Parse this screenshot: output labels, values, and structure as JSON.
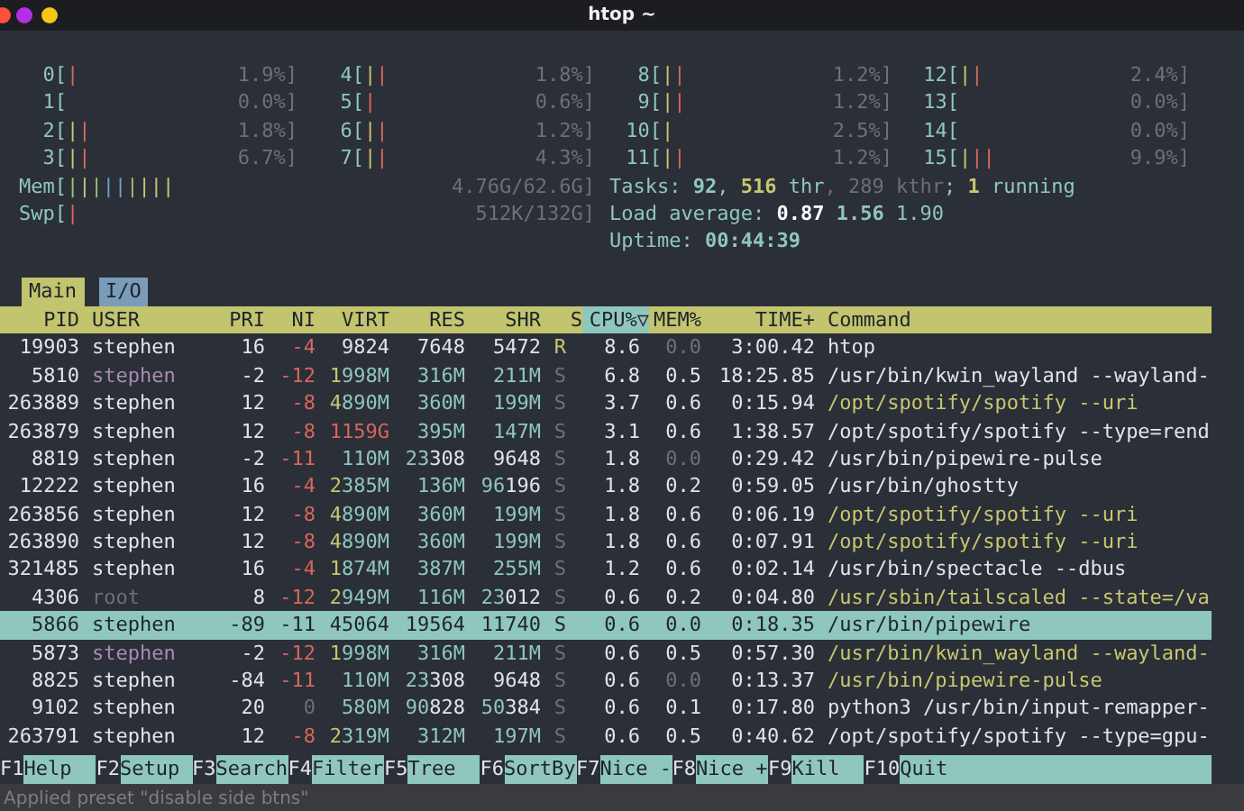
{
  "window": {
    "title": "htop ~"
  },
  "cpu_meters": [
    {
      "label": "0[",
      "bars": [
        {
          "text": "|",
          "color": "#d9665c"
        }
      ],
      "reading": "1.9%]"
    },
    {
      "label": "1[",
      "reading": "0.0%]"
    },
    {
      "label": "2[",
      "bars": [
        {
          "text": "|",
          "color": "#c8c76e"
        },
        {
          "text": "|",
          "color": "#d9665c"
        }
      ],
      "reading": "1.8%]"
    },
    {
      "label": "3[",
      "bars": [
        {
          "text": "|",
          "color": "#c8c76e"
        },
        {
          "text": "|",
          "color": "#d9665c"
        }
      ],
      "reading": "6.7%]"
    },
    {
      "label": "4[",
      "bars": [
        {
          "text": "|",
          "color": "#c8c76e"
        },
        {
          "text": "|",
          "color": "#d9665c"
        }
      ],
      "reading": "1.8%]"
    },
    {
      "label": "5[",
      "bars": [
        {
          "text": "|",
          "color": "#d9665c"
        }
      ],
      "reading": "0.6%]"
    },
    {
      "label": "6[",
      "bars": [
        {
          "text": "|",
          "color": "#c8c76e"
        },
        {
          "text": "|",
          "color": "#d9665c"
        }
      ],
      "reading": "1.2%]"
    },
    {
      "label": "7[",
      "bars": [
        {
          "text": "|",
          "color": "#c8c76e"
        },
        {
          "text": "|",
          "color": "#d9665c"
        }
      ],
      "reading": "4.3%]"
    },
    {
      "label": "8[",
      "bars": [
        {
          "text": "|",
          "color": "#c8c76e"
        },
        {
          "text": "|",
          "color": "#d9665c"
        }
      ],
      "reading": "1.2%]"
    },
    {
      "label": "9[",
      "bars": [
        {
          "text": "|",
          "color": "#c8c76e"
        },
        {
          "text": "|",
          "color": "#d9665c"
        }
      ],
      "reading": "1.2%]"
    },
    {
      "label": "10[",
      "bars": [
        {
          "text": "|",
          "color": "#c8c76e"
        }
      ],
      "reading": "2.5%]"
    },
    {
      "label": "11[",
      "bars": [
        {
          "text": "|",
          "color": "#c8c76e"
        },
        {
          "text": "|",
          "color": "#d9665c"
        }
      ],
      "reading": "1.2%]"
    },
    {
      "label": "12[",
      "bars": [
        {
          "text": "|",
          "color": "#c8c76e"
        },
        {
          "text": "|",
          "color": "#d9665c"
        }
      ],
      "reading": "2.4%]"
    },
    {
      "label": "13[",
      "reading": "0.0%]"
    },
    {
      "label": "14[",
      "reading": "0.0%]"
    },
    {
      "label": "15[",
      "bars": [
        {
          "text": "|",
          "color": "#c8c76e"
        },
        {
          "text": "||",
          "color": "#d9665c"
        }
      ],
      "reading": "9.9%]"
    }
  ],
  "memory_meters": [
    {
      "label": "Mem[",
      "bars": [
        {
          "text": "|",
          "color": "#9ec16c"
        },
        {
          "text": "|",
          "color": "#c8c76e"
        },
        {
          "text": "|",
          "color": "#9ec16c"
        },
        {
          "text": "||",
          "color": "#6d9ec9"
        },
        {
          "text": "|",
          "color": "#9ec16c"
        },
        {
          "text": "|||",
          "color": "#c8c76e"
        }
      ],
      "reading": "4.76G/62.6G]"
    },
    {
      "label": "Swp[",
      "bars": [
        {
          "text": "|",
          "color": "#d9665c"
        }
      ],
      "reading": "512K/132G]"
    }
  ],
  "summary": [
    [
      {
        "text": "Tasks: ",
        "color": "#8fc7bd"
      },
      {
        "text": "92",
        "color": "#8fc7bd",
        "bold": true
      },
      {
        "text": ", ",
        "color": "#8fc7bd"
      },
      {
        "text": "516",
        "color": "#c8c76e",
        "bold": true
      },
      {
        "text": " thr",
        "color": "#8fc7bd"
      },
      {
        "text": ", 289 kthr",
        "color": "#6b707a"
      },
      {
        "text": "; ",
        "color": "#8fc7bd"
      },
      {
        "text": "1",
        "color": "#c8c76e",
        "bold": true
      },
      {
        "text": " running",
        "color": "#8fc7bd"
      }
    ],
    [
      {
        "text": "Load average: ",
        "color": "#8fc7bd"
      },
      {
        "text": "0.87",
        "color": "#ffffff",
        "bold": true
      },
      {
        "text": " 1.56",
        "color": "#8fc7bd",
        "bold": true
      },
      {
        "text": " 1.90",
        "color": "#8fc7bd"
      }
    ],
    [
      {
        "text": "Uptime: ",
        "color": "#8fc7bd"
      },
      {
        "text": "00:44:39",
        "color": "#8fc7bd",
        "bold": true
      }
    ]
  ],
  "tabs": [
    {
      "label": "Main",
      "selected": true
    },
    {
      "label": "I/O",
      "selected": false
    }
  ],
  "columns": [
    {
      "label": "PID",
      "selected": false
    },
    {
      "label": "USER",
      "selected": false
    },
    {
      "label": "PRI",
      "selected": false
    },
    {
      "label": "NI",
      "selected": false
    },
    {
      "label": "VIRT",
      "selected": false
    },
    {
      "label": "RES",
      "selected": false
    },
    {
      "label": "SHR",
      "selected": false
    },
    {
      "label": "S",
      "selected": false
    },
    {
      "label": "CPU%▽",
      "selected": true
    },
    {
      "label": "MEM%",
      "selected": false
    },
    {
      "label": "TIME+",
      "selected": false
    },
    {
      "label": "Command",
      "selected": false
    }
  ],
  "processes": [
    {
      "selected": false,
      "cells": [
        "19903",
        "stephen",
        "16",
        [
          {
            "text": "-4",
            "color": "#d9665c"
          }
        ],
        "9824",
        "7648",
        "5472",
        [
          {
            "text": "R",
            "color": "#c8c76e"
          }
        ],
        "8.6",
        [
          {
            "text": "0.0",
            "color": "#6b707a"
          }
        ],
        "3:00.42",
        "htop"
      ]
    },
    {
      "selected": false,
      "cells": [
        "5810",
        [
          {
            "text": "stephen",
            "color": "#a98bb3"
          }
        ],
        "-2",
        [
          {
            "text": "-12",
            "color": "#d9665c"
          }
        ],
        [
          {
            "text": "1",
            "color": "#c8c76e"
          },
          {
            "text": "998M",
            "color": "#8fc7bd"
          }
        ],
        [
          {
            "text": "316M",
            "color": "#8fc7bd"
          }
        ],
        [
          {
            "text": "211M",
            "color": "#8fc7bd"
          }
        ],
        [
          {
            "text": "S",
            "color": "#6b707a"
          }
        ],
        "6.8",
        "0.5",
        "18:25.85",
        "/usr/bin/kwin_wayland --wayland-"
      ]
    },
    {
      "selected": false,
      "cells": [
        "263889",
        "stephen",
        "12",
        [
          {
            "text": "-8",
            "color": "#d9665c"
          }
        ],
        [
          {
            "text": "4",
            "color": "#c8c76e"
          },
          {
            "text": "890M",
            "color": "#8fc7bd"
          }
        ],
        [
          {
            "text": "360M",
            "color": "#8fc7bd"
          }
        ],
        [
          {
            "text": "199M",
            "color": "#8fc7bd"
          }
        ],
        [
          {
            "text": "S",
            "color": "#6b707a"
          }
        ],
        "3.7",
        "0.6",
        "0:15.94",
        [
          {
            "text": "/opt/spotify/spotify --uri",
            "color": "#c8c76e"
          }
        ]
      ]
    },
    {
      "selected": false,
      "cells": [
        "263879",
        "stephen",
        "12",
        [
          {
            "text": "-8",
            "color": "#d9665c"
          }
        ],
        [
          {
            "text": "1159G",
            "color": "#d9665c"
          }
        ],
        [
          {
            "text": "395M",
            "color": "#8fc7bd"
          }
        ],
        [
          {
            "text": "147M",
            "color": "#8fc7bd"
          }
        ],
        [
          {
            "text": "S",
            "color": "#6b707a"
          }
        ],
        "3.1",
        "0.6",
        "1:38.57",
        "/opt/spotify/spotify --type=rend"
      ]
    },
    {
      "selected": false,
      "cells": [
        "8819",
        "stephen",
        "-2",
        [
          {
            "text": "-11",
            "color": "#d9665c"
          }
        ],
        [
          {
            "text": "110M",
            "color": "#8fc7bd"
          }
        ],
        [
          {
            "text": "23",
            "color": "#8fc7bd"
          },
          {
            "text": "308",
            "color": "#e2e4e6"
          }
        ],
        "9648",
        [
          {
            "text": "S",
            "color": "#6b707a"
          }
        ],
        "1.8",
        [
          {
            "text": "0.0",
            "color": "#6b707a"
          }
        ],
        "0:29.42",
        "/usr/bin/pipewire-pulse"
      ]
    },
    {
      "selected": false,
      "cells": [
        "12222",
        "stephen",
        "16",
        [
          {
            "text": "-4",
            "color": "#d9665c"
          }
        ],
        [
          {
            "text": "2",
            "color": "#c8c76e"
          },
          {
            "text": "385M",
            "color": "#8fc7bd"
          }
        ],
        [
          {
            "text": "136M",
            "color": "#8fc7bd"
          }
        ],
        [
          {
            "text": "96",
            "color": "#8fc7bd"
          },
          {
            "text": "196",
            "color": "#e2e4e6"
          }
        ],
        [
          {
            "text": "S",
            "color": "#6b707a"
          }
        ],
        "1.8",
        "0.2",
        "0:59.05",
        "/usr/bin/ghostty"
      ]
    },
    {
      "selected": false,
      "cells": [
        "263856",
        "stephen",
        "12",
        [
          {
            "text": "-8",
            "color": "#d9665c"
          }
        ],
        [
          {
            "text": "4",
            "color": "#c8c76e"
          },
          {
            "text": "890M",
            "color": "#8fc7bd"
          }
        ],
        [
          {
            "text": "360M",
            "color": "#8fc7bd"
          }
        ],
        [
          {
            "text": "199M",
            "color": "#8fc7bd"
          }
        ],
        [
          {
            "text": "S",
            "color": "#6b707a"
          }
        ],
        "1.8",
        "0.6",
        "0:06.19",
        [
          {
            "text": "/opt/spotify/spotify --uri",
            "color": "#c8c76e"
          }
        ]
      ]
    },
    {
      "selected": false,
      "cells": [
        "263890",
        "stephen",
        "12",
        [
          {
            "text": "-8",
            "color": "#d9665c"
          }
        ],
        [
          {
            "text": "4",
            "color": "#c8c76e"
          },
          {
            "text": "890M",
            "color": "#8fc7bd"
          }
        ],
        [
          {
            "text": "360M",
            "color": "#8fc7bd"
          }
        ],
        [
          {
            "text": "199M",
            "color": "#8fc7bd"
          }
        ],
        [
          {
            "text": "S",
            "color": "#6b707a"
          }
        ],
        "1.8",
        "0.6",
        "0:07.91",
        [
          {
            "text": "/opt/spotify/spotify --uri",
            "color": "#c8c76e"
          }
        ]
      ]
    },
    {
      "selected": false,
      "cells": [
        "321485",
        "stephen",
        "16",
        [
          {
            "text": "-4",
            "color": "#d9665c"
          }
        ],
        [
          {
            "text": "1",
            "color": "#c8c76e"
          },
          {
            "text": "874M",
            "color": "#8fc7bd"
          }
        ],
        [
          {
            "text": "387M",
            "color": "#8fc7bd"
          }
        ],
        [
          {
            "text": "255M",
            "color": "#8fc7bd"
          }
        ],
        [
          {
            "text": "S",
            "color": "#6b707a"
          }
        ],
        "1.2",
        "0.6",
        "0:02.14",
        "/usr/bin/spectacle --dbus"
      ]
    },
    {
      "selected": false,
      "cells": [
        "4306",
        [
          {
            "text": "root",
            "color": "#6b707a"
          }
        ],
        "8",
        [
          {
            "text": "-12",
            "color": "#d9665c"
          }
        ],
        [
          {
            "text": "2",
            "color": "#c8c76e"
          },
          {
            "text": "949M",
            "color": "#8fc7bd"
          }
        ],
        [
          {
            "text": "116M",
            "color": "#8fc7bd"
          }
        ],
        [
          {
            "text": "23",
            "color": "#8fc7bd"
          },
          {
            "text": "012",
            "color": "#e2e4e6"
          }
        ],
        [
          {
            "text": "S",
            "color": "#6b707a"
          }
        ],
        "0.6",
        "0.2",
        "0:04.80",
        [
          {
            "text": "/usr/sbin/tailscaled --state=/va",
            "color": "#c8c76e"
          }
        ]
      ]
    },
    {
      "selected": true,
      "cells": [
        "5866",
        "stephen",
        "-89",
        "-11",
        "45064",
        "19564",
        "11740",
        "S",
        "0.6",
        "0.0",
        "0:18.35",
        "/usr/bin/pipewire"
      ]
    },
    {
      "selected": false,
      "cells": [
        "5873",
        [
          {
            "text": "stephen",
            "color": "#a98bb3"
          }
        ],
        "-2",
        [
          {
            "text": "-12",
            "color": "#d9665c"
          }
        ],
        [
          {
            "text": "1",
            "color": "#c8c76e"
          },
          {
            "text": "998M",
            "color": "#8fc7bd"
          }
        ],
        [
          {
            "text": "316M",
            "color": "#8fc7bd"
          }
        ],
        [
          {
            "text": "211M",
            "color": "#8fc7bd"
          }
        ],
        [
          {
            "text": "S",
            "color": "#6b707a"
          }
        ],
        "0.6",
        "0.5",
        "0:57.30",
        [
          {
            "text": "/usr/bin/kwin_wayland --wayland-",
            "color": "#c8c76e"
          }
        ]
      ]
    },
    {
      "selected": false,
      "cells": [
        "8825",
        "stephen",
        "-84",
        [
          {
            "text": "-11",
            "color": "#d9665c"
          }
        ],
        [
          {
            "text": "110M",
            "color": "#8fc7bd"
          }
        ],
        [
          {
            "text": "23",
            "color": "#8fc7bd"
          },
          {
            "text": "308",
            "color": "#e2e4e6"
          }
        ],
        "9648",
        [
          {
            "text": "S",
            "color": "#6b707a"
          }
        ],
        "0.6",
        [
          {
            "text": "0.0",
            "color": "#6b707a"
          }
        ],
        "0:13.37",
        [
          {
            "text": "/usr/bin/pipewire-pulse",
            "color": "#c8c76e"
          }
        ]
      ]
    },
    {
      "selected": false,
      "cells": [
        "9102",
        "stephen",
        "20",
        [
          {
            "text": "0",
            "color": "#6b707a"
          }
        ],
        [
          {
            "text": "580M",
            "color": "#8fc7bd"
          }
        ],
        [
          {
            "text": "90",
            "color": "#8fc7bd"
          },
          {
            "text": "828",
            "color": "#e2e4e6"
          }
        ],
        [
          {
            "text": "50",
            "color": "#8fc7bd"
          },
          {
            "text": "384",
            "color": "#e2e4e6"
          }
        ],
        [
          {
            "text": "S",
            "color": "#6b707a"
          }
        ],
        "0.6",
        "0.1",
        "0:17.80",
        "python3 /usr/bin/input-remapper-"
      ]
    },
    {
      "selected": false,
      "cells": [
        "263791",
        "stephen",
        "12",
        [
          {
            "text": "-8",
            "color": "#d9665c"
          }
        ],
        [
          {
            "text": "2",
            "color": "#c8c76e"
          },
          {
            "text": "319M",
            "color": "#8fc7bd"
          }
        ],
        [
          {
            "text": "312M",
            "color": "#8fc7bd"
          }
        ],
        [
          {
            "text": "197M",
            "color": "#8fc7bd"
          }
        ],
        [
          {
            "text": "S",
            "color": "#6b707a"
          }
        ],
        "0.6",
        "0.5",
        "0:40.62",
        "/opt/spotify/spotify --type=gpu-"
      ]
    }
  ],
  "function_keys": [
    {
      "key": "F1",
      "label": "Help"
    },
    {
      "key": "F2",
      "label": "Setup"
    },
    {
      "key": "F3",
      "label": "Search"
    },
    {
      "key": "F4",
      "label": "Filter"
    },
    {
      "key": "F5",
      "label": "Tree"
    },
    {
      "key": "F6",
      "label": "SortBy"
    },
    {
      "key": "F7",
      "label": "Nice -"
    },
    {
      "key": "F8",
      "label": "Nice +"
    },
    {
      "key": "F9",
      "label": "Kill"
    },
    {
      "key": "F10",
      "label": "Quit"
    }
  ],
  "status_message": "Applied preset \"disable side btns\""
}
